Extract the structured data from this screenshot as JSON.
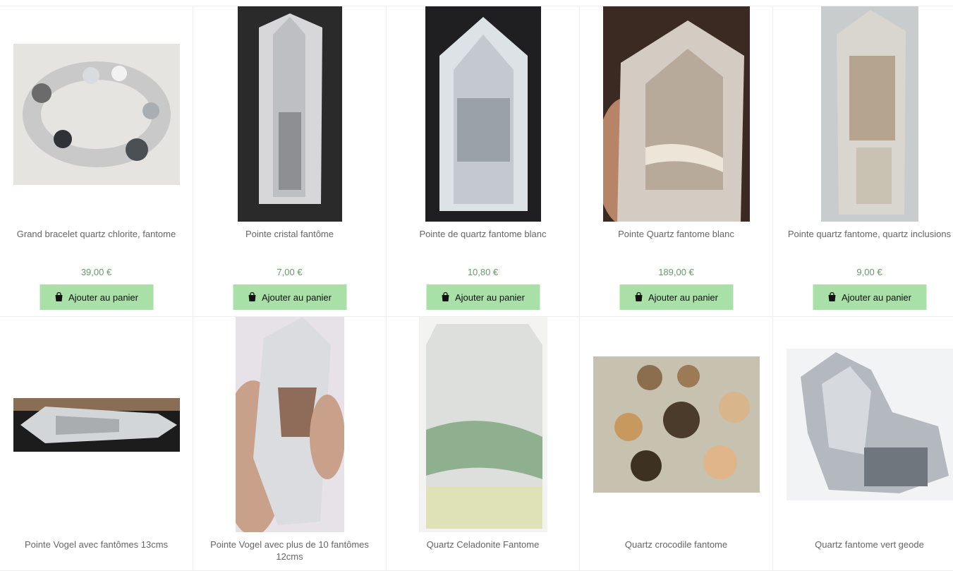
{
  "products": [
    {
      "name": "Grand bracelet quartz chlorite, fantome",
      "price": "39,00 €",
      "button": "Ajouter au panier",
      "image": "quartz-bracelet-image"
    },
    {
      "name": "Pointe cristal fantôme",
      "price": "7,00 €",
      "button": "Ajouter au panier",
      "image": "crystal-point-image"
    },
    {
      "name": "Pointe de quartz fantome blanc",
      "price": "10,80 €",
      "button": "Ajouter au panier",
      "image": "white-phantom-point-image"
    },
    {
      "name": "Pointe Quartz fantome blanc",
      "price": "189,00 €",
      "button": "Ajouter au panier",
      "image": "quartz-point-hand-image"
    },
    {
      "name": "Pointe quartz fantome, quartz inclusions",
      "price": "9,00 €",
      "button": "Ajouter au panier",
      "image": "quartz-inclusions-image"
    },
    {
      "name": "Pointe Vogel avec fantômes 13cms",
      "image": "vogel-point-image"
    },
    {
      "name": "Pointe Vogel avec plus de 10 fantômes 12cms",
      "image": "vogel-point-hand-image"
    },
    {
      "name": "Quartz Celadonite Fantome",
      "image": "celadonite-quartz-image"
    },
    {
      "name": "Quartz crocodile fantome",
      "image": "crocodile-quartz-image"
    },
    {
      "name": "Quartz fantome vert geode",
      "image": "geode-quartz-image"
    }
  ],
  "colors": {
    "button_bg": "#a8e0a8",
    "price": "#6a9a6a",
    "text": "#666666"
  }
}
